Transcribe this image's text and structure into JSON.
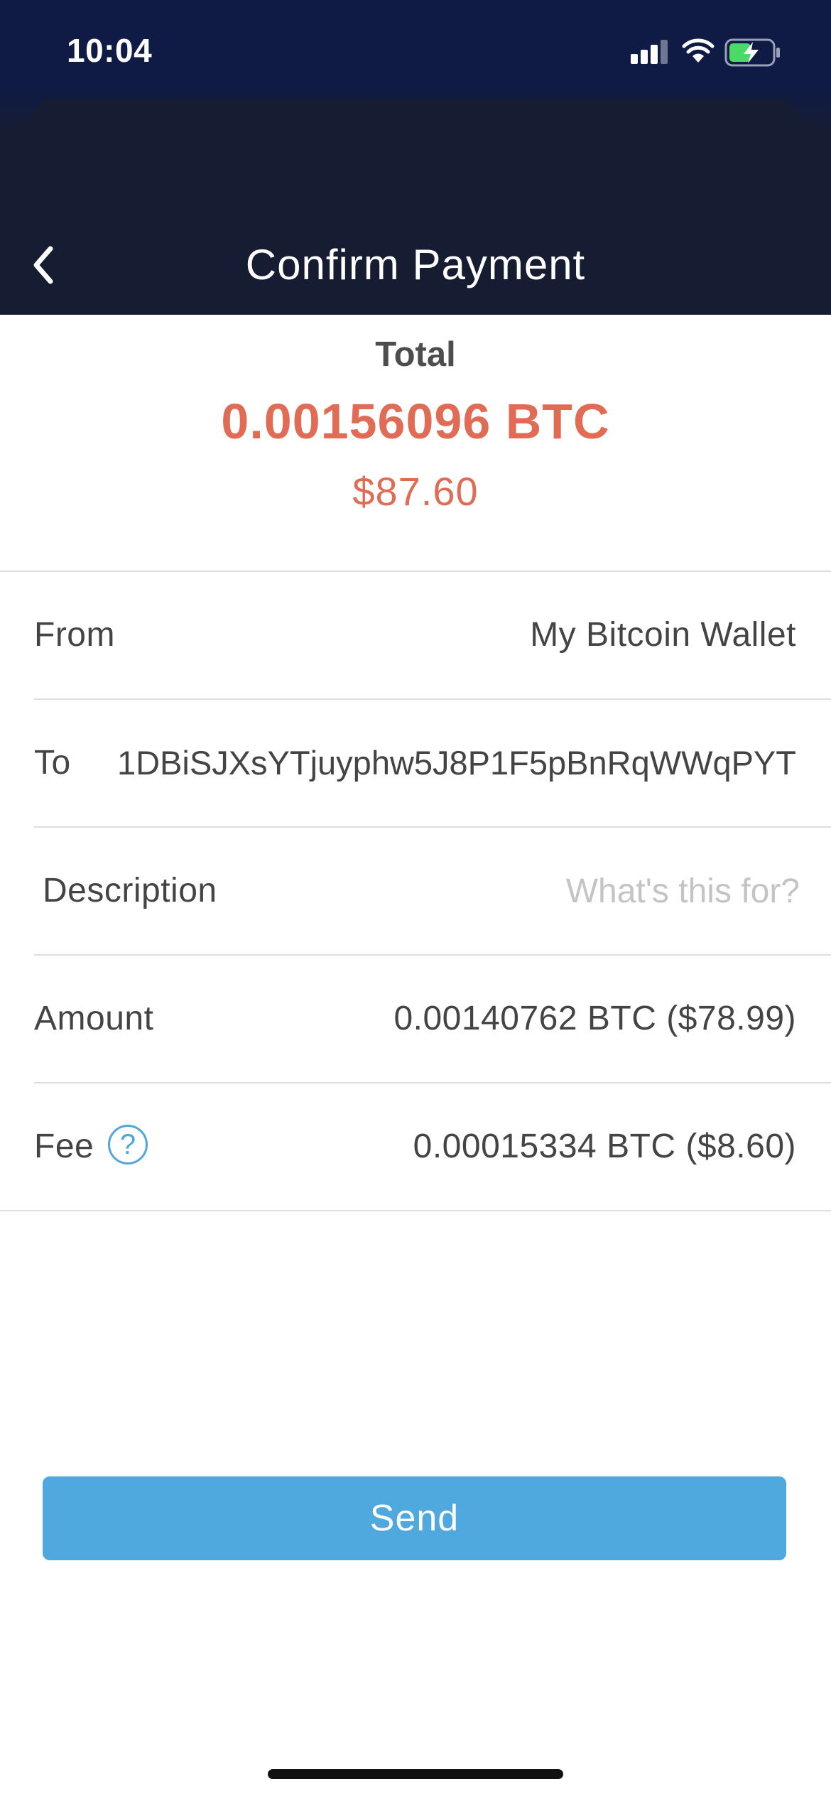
{
  "status_bar": {
    "time": "10:04",
    "icons": [
      "cellular-signal-icon",
      "wifi-icon",
      "battery-charging-icon"
    ]
  },
  "nav": {
    "back_icon": "chevron-left-icon",
    "title": "Confirm Payment"
  },
  "total": {
    "label": "Total",
    "btc": "0.00156096 BTC",
    "usd": "$87.60"
  },
  "details": {
    "from": {
      "label": "From",
      "value": "My Bitcoin Wallet"
    },
    "to": {
      "label": "To",
      "value": "1DBiSJXsYTjuyphw5J8P1F5pBnRqWWqPYT"
    },
    "description": {
      "label": "Description",
      "placeholder": "What's this for?",
      "value": ""
    },
    "amount": {
      "label": "Amount",
      "value": "0.00140762 BTC ($78.99)"
    },
    "fee": {
      "label": "Fee",
      "help_icon": "question-circle-icon",
      "help_symbol": "?",
      "value": "0.00015334 BTC ($8.60)"
    }
  },
  "actions": {
    "send_label": "Send"
  },
  "colors": {
    "header_top": "#0f1b45",
    "header_sheet": "#161c31",
    "total_accent": "#e06c55",
    "send_button": "#4fa9df",
    "help_icon": "#4fa7de",
    "divider": "#dedede"
  }
}
